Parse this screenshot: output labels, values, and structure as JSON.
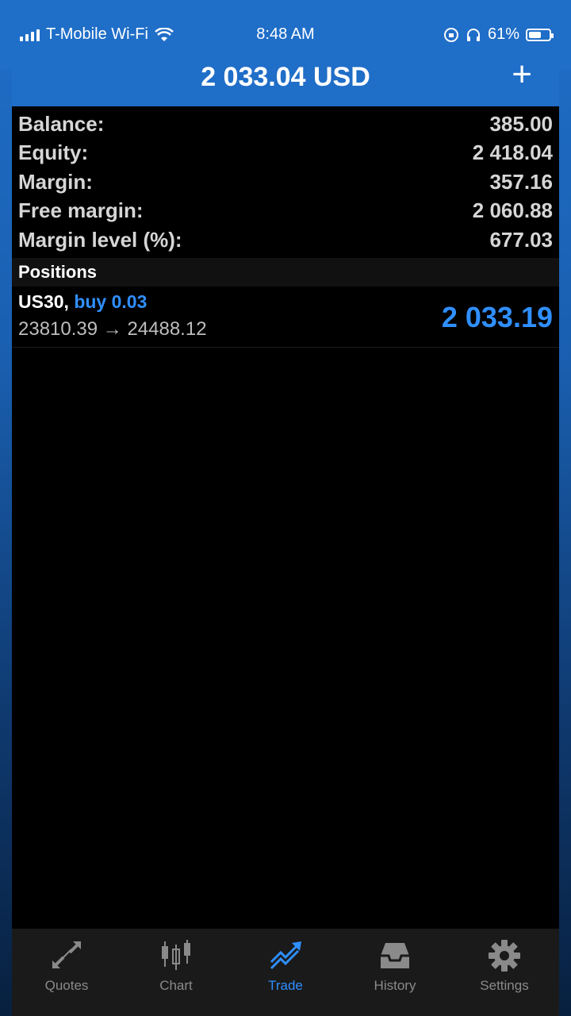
{
  "status_bar": {
    "carrier": "T-Mobile Wi-Fi",
    "time": "8:48 AM",
    "battery_percent": "61%",
    "battery_level": 0.61
  },
  "header": {
    "title": "2 033.04 USD",
    "add_label": "+"
  },
  "summary": [
    {
      "label": "Balance:",
      "value": "385.00"
    },
    {
      "label": "Equity:",
      "value": "2 418.04"
    },
    {
      "label": "Margin:",
      "value": "357.16"
    },
    {
      "label": "Free margin:",
      "value": "2 060.88"
    },
    {
      "label": "Margin level (%):",
      "value": "677.03"
    }
  ],
  "positions": {
    "title": "Positions",
    "items": [
      {
        "symbol": "US30,",
        "direction": "buy 0.03",
        "prices": "23810.39 → 24488.12",
        "profit": "2 033.19"
      }
    ]
  },
  "tabs": [
    {
      "label": "Quotes",
      "icon": "quotes-icon"
    },
    {
      "label": "Chart",
      "icon": "chart-icon"
    },
    {
      "label": "Trade",
      "icon": "trade-icon",
      "active": true
    },
    {
      "label": "History",
      "icon": "history-icon"
    },
    {
      "label": "Settings",
      "icon": "settings-icon"
    }
  ],
  "colors": {
    "accent": "#2f8fff",
    "header_bg": "#1f6ec8",
    "content_bg": "#000000"
  }
}
